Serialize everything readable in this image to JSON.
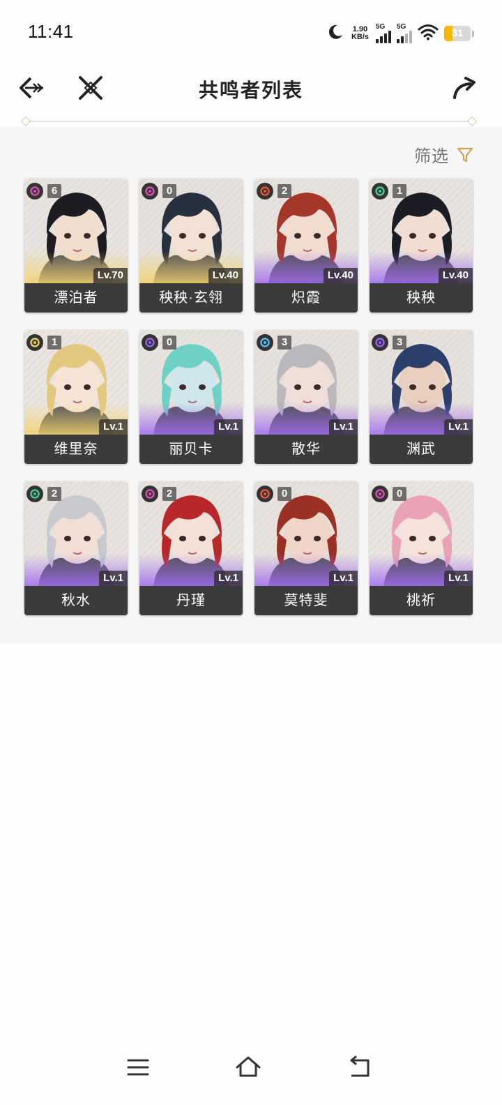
{
  "status_bar": {
    "time": "11:41",
    "net_speed_value": "1.90",
    "net_speed_unit": "KB/s",
    "signal1_label": "5G",
    "signal2_label": "5G",
    "battery_percent": "31",
    "battery_level": 0.31
  },
  "header": {
    "title": "共鸣者列表",
    "back_icon": "back-arrow-icon",
    "close_icon": "crossed-swords-icon",
    "share_icon": "share-arrow-icon"
  },
  "filter": {
    "label": "筛选",
    "icon": "funnel-icon"
  },
  "colors": {
    "five_star_glow": "#a16bf0",
    "four_star_glow": "#f2d36b",
    "name_bar": "#3b3b3b",
    "filter_icon": "#c9a24a"
  },
  "characters": [
    {
      "name": "漂泊者",
      "level": "Lv.70",
      "chain": "6",
      "element": "havoc",
      "element_color": "#d64fb4",
      "rarity": "four",
      "hair": "#1c1c22",
      "skin": "#f1ddcd",
      "bg": "#e9e4df"
    },
    {
      "name": "秧秧·玄翎",
      "level": "Lv.40",
      "chain": "0",
      "element": "havoc",
      "element_color": "#d64fb4",
      "rarity": "four",
      "hair": "#27303f",
      "skin": "#f3e1d6",
      "bg": "#e6e1dc"
    },
    {
      "name": "炽霞",
      "level": "Lv.40",
      "chain": "2",
      "element": "fusion",
      "element_color": "#e8553a",
      "rarity": "five",
      "hair": "#a4362a",
      "skin": "#f2dcd0",
      "bg": "#e7e2dd"
    },
    {
      "name": "秧秧",
      "level": "Lv.40",
      "chain": "1",
      "element": "aero",
      "element_color": "#47c997",
      "rarity": "five",
      "hair": "#1c1c24",
      "skin": "#f1ddd1",
      "bg": "#e8e3de"
    },
    {
      "name": "维里奈",
      "level": "Lv.1",
      "chain": "1",
      "element": "spectro",
      "element_color": "#e6cf62",
      "rarity": "four",
      "hair": "#e3c97f",
      "skin": "#f6e4d4",
      "bg": "#ebe6df"
    },
    {
      "name": "丽贝卡",
      "level": "Lv.1",
      "chain": "0",
      "element": "electro",
      "element_color": "#9a5cf0",
      "rarity": "five",
      "hair": "#6fd1c4",
      "skin": "#cfe7ea",
      "bg": "#e7e3de"
    },
    {
      "name": "散华",
      "level": "Lv.1",
      "chain": "3",
      "element": "glacio",
      "element_color": "#5cb7f0",
      "rarity": "five",
      "hair": "#b9b9bd",
      "skin": "#f0dfd8",
      "bg": "#e6e1dc"
    },
    {
      "name": "渊武",
      "level": "Lv.1",
      "chain": "3",
      "element": "electro",
      "element_color": "#9a5cf0",
      "rarity": "five",
      "hair": "#2b3f6a",
      "skin": "#e9cfbf",
      "bg": "#e6e1dc"
    },
    {
      "name": "秋水",
      "level": "Lv.1",
      "chain": "2",
      "element": "aero",
      "element_color": "#47c997",
      "rarity": "five",
      "hair": "#c7c9cf",
      "skin": "#f2e0d6",
      "bg": "#e8e3de"
    },
    {
      "name": "丹瑾",
      "level": "Lv.1",
      "chain": "2",
      "element": "havoc",
      "element_color": "#d64fb4",
      "rarity": "five",
      "hair": "#b8282b",
      "skin": "#f4e0d6",
      "bg": "#e8e3de"
    },
    {
      "name": "莫特斐",
      "level": "Lv.1",
      "chain": "0",
      "element": "fusion",
      "element_color": "#e8553a",
      "rarity": "five",
      "hair": "#9a3124",
      "skin": "#efd6c9",
      "bg": "#e7e2dd"
    },
    {
      "name": "桃祈",
      "level": "Lv.1",
      "chain": "0",
      "element": "havoc",
      "element_color": "#d64fb4",
      "rarity": "five",
      "hair": "#e9a2b6",
      "skin": "#f5e3dc",
      "bg": "#ebe5e1"
    }
  ],
  "navbar": {
    "menu_icon": "menu-icon",
    "home_icon": "home-icon",
    "back_icon": "back-icon"
  }
}
